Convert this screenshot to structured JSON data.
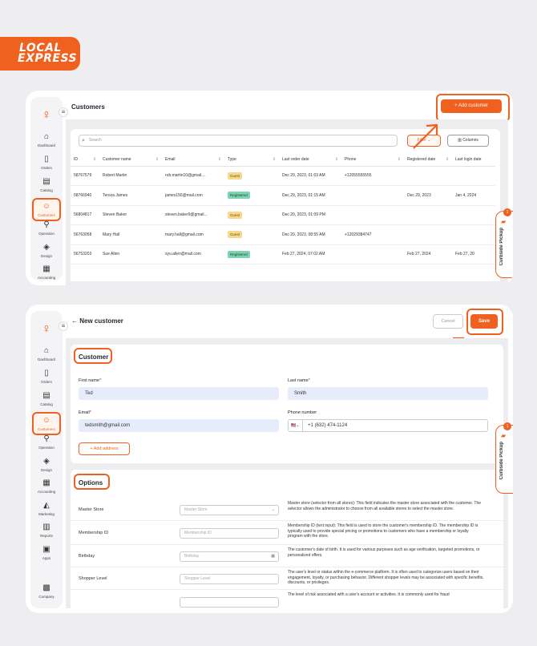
{
  "logo": {
    "line1": "LOCAL",
    "line2": "EXPRESS"
  },
  "nav_top": [
    {
      "label": "Dashboard",
      "icon": "home-icon",
      "glyph": "⌂"
    },
    {
      "label": "Orders",
      "icon": "bag-icon",
      "glyph": "▯"
    },
    {
      "label": "Catalog",
      "icon": "catalog-icon",
      "glyph": "▤"
    },
    {
      "label": "Customers",
      "icon": "users-icon",
      "glyph": "☺"
    },
    {
      "label": "Operation",
      "icon": "operation-icon",
      "glyph": "⚲"
    },
    {
      "label": "Design",
      "icon": "brush-icon",
      "glyph": "◈"
    },
    {
      "label": "Accounting",
      "icon": "ledger-icon",
      "glyph": "▦"
    }
  ],
  "nav_bottom": [
    {
      "label": "Dashboard",
      "icon": "home-icon",
      "glyph": "⌂"
    },
    {
      "label": "Orders",
      "icon": "bag-icon",
      "glyph": "▯"
    },
    {
      "label": "Catalog",
      "icon": "catalog-icon",
      "glyph": "▤"
    },
    {
      "label": "Customers",
      "icon": "users-icon",
      "glyph": "☺"
    },
    {
      "label": "Operation",
      "icon": "operation-icon",
      "glyph": "⚲"
    },
    {
      "label": "Design",
      "icon": "brush-icon",
      "glyph": "◈"
    },
    {
      "label": "Accounting",
      "icon": "ledger-icon",
      "glyph": "▦"
    },
    {
      "label": "Marketing",
      "icon": "megaphone-icon",
      "glyph": "◭"
    },
    {
      "label": "Reports",
      "icon": "chart-icon",
      "glyph": "▥"
    },
    {
      "label": "Apps",
      "icon": "apps-icon",
      "glyph": "▣"
    },
    {
      "label": "Company",
      "icon": "company-icon",
      "glyph": "▩"
    }
  ],
  "customers_page": {
    "title": "Customers",
    "add_button": "Add customer",
    "search_placeholder": "Search",
    "filter_label": "Filter",
    "columns_label": "Columns",
    "headers": [
      "ID",
      "Customer name",
      "Email",
      "Type",
      "Last order date",
      "Phone",
      "Registered date",
      "Last login date"
    ],
    "rows": [
      {
        "id": "58767579",
        "name": "Robert Martin",
        "email": "rob.martin10@gmail....",
        "type": "Guest",
        "last_order": "Dec 29, 2023, 01:03 AM",
        "phone": "+12055555555",
        "registered": "",
        "last_login": ""
      },
      {
        "id": "58766940",
        "name": "Tereza James",
        "email": "james156@mail.com",
        "type": "Registered",
        "last_order": "Dec 29, 2023, 01:15 AM",
        "phone": "",
        "registered": "Dec 29, 2023",
        "last_login": "Jan 4, 2024"
      },
      {
        "id": "56804817",
        "name": "Steven Baker",
        "email": "steven.baker9@gmail...",
        "type": "Guest",
        "last_order": "Dec 20, 2023, 01:09 PM",
        "phone": "",
        "registered": "",
        "last_login": ""
      },
      {
        "id": "56763058",
        "name": "Mary Hall",
        "email": "mary.hall@gmail.com",
        "type": "Guest",
        "last_order": "Dec 20, 2023, 08:55 AM",
        "phone": "+12029384747",
        "registered": "",
        "last_login": ""
      },
      {
        "id": "56753203",
        "name": "Sue Allen",
        "email": "syu.allen@mail.com",
        "type": "Registered",
        "last_order": "Feb 27, 2024, 07:02 AM",
        "phone": "",
        "registered": "Feb 27, 2024",
        "last_login": "Feb 27, 20"
      }
    ]
  },
  "curbside": {
    "label": "Curbside Pickup",
    "count": "1"
  },
  "new_customer": {
    "title": "New customer",
    "cancel_label": "Cancel",
    "save_label": "Save",
    "section_customer": "Customer",
    "first_name_label": "First name",
    "first_name_value": "Ted",
    "last_name_label": "Last name",
    "last_name_value": "Smith",
    "email_label": "Email",
    "email_value": "tedsmith@gmail.com",
    "phone_label": "Phone number",
    "phone_value": "+1 (632) 474-1124",
    "add_address": "Add address",
    "section_options": "Options",
    "options": [
      {
        "label": "Master Store",
        "placeholder": "Master Store",
        "suffix": "⌄",
        "description": "Master store (selector from all stores): This field indicates the master store associated with the customer. The selector allows the administrator to choose from all available stores to select the master store."
      },
      {
        "label": "Membership ID",
        "placeholder": "Membership ID",
        "suffix": "",
        "description": "Membership ID (text input): This field is used to store the customer's membership ID. The membership ID is typically used to provide special pricing or promotions to customers who have a membership or loyalty program with the store."
      },
      {
        "label": "Birthday",
        "placeholder": "Birthday",
        "suffix": "▦",
        "description": "The customer's date of birth. It is used for various purposes such as age verification, targeted promotions, or personalized offers."
      },
      {
        "label": "Shopper Level",
        "placeholder": "Shopper Level",
        "suffix": "",
        "description": "The user's level or status within the e-commerce platform. It is often used to categorize users based on their engagement, loyalty, or purchasing behavior. Different shopper levels may be associated with specific benefits, discounts, or privileges."
      },
      {
        "label": "",
        "placeholder": "",
        "suffix": "",
        "description": "The level of risk associated with a user's account or activities. It is commonly used for fraud"
      }
    ]
  }
}
